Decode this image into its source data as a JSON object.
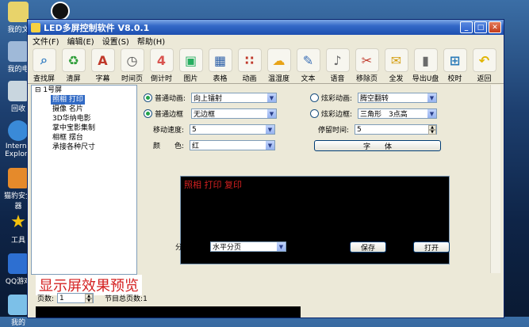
{
  "desktop": {
    "icons": [
      "我的文",
      "我的电",
      "回收",
      "Interne Explore",
      "猫豹安全 器",
      "工具",
      "QQ游戏",
      "我的"
    ]
  },
  "window": {
    "title": "LED多屏控制软件 V8.0.1",
    "menu": [
      "文件(F)",
      "编辑(E)",
      "设置(S)",
      "帮助(H)"
    ]
  },
  "toolbar": {
    "items": [
      {
        "label": "查找屏",
        "icon": "search-icon",
        "color": "#3b82c4"
      },
      {
        "label": "清屏",
        "icon": "recycle-icon",
        "color": "#2f9e3a"
      },
      {
        "label": "字幕",
        "icon": "text-a-icon",
        "color": "#c0392b"
      },
      {
        "label": "时间页",
        "icon": "clock-icon",
        "color": "#555555"
      },
      {
        "label": "倒计时",
        "icon": "calendar-icon",
        "color": "#d9534f"
      },
      {
        "label": "图片",
        "icon": "picture-icon",
        "color": "#27ae60"
      },
      {
        "label": "表格",
        "icon": "table-icon",
        "color": "#2c5fa8"
      },
      {
        "label": "动画",
        "icon": "animation-icon",
        "color": "#c0392b"
      },
      {
        "label": "温湿度",
        "icon": "weather-icon",
        "color": "#e8a317"
      },
      {
        "label": "文本",
        "icon": "document-icon",
        "color": "#3b6fb6"
      },
      {
        "label": "语音",
        "icon": "speaker-icon",
        "color": "#6b6b6b"
      },
      {
        "label": "移除页",
        "icon": "scissors-icon",
        "color": "#c0392b"
      },
      {
        "label": "全发",
        "icon": "send-mail-icon",
        "color": "#d4a017"
      },
      {
        "label": "导出U盘",
        "icon": "usb-icon",
        "color": "#6b6b6b"
      },
      {
        "label": "校时",
        "icon": "windows-icon",
        "color": "#2a7ab8"
      },
      {
        "label": "返回",
        "icon": "back-arrow-icon",
        "color": "#e0b400"
      }
    ]
  },
  "tree": {
    "root": "1号屏",
    "items": [
      "照相 打印",
      "摄像 名片",
      "3D华纳电影",
      "掌中宝影集制",
      "相框 摆台",
      "承接各种尺寸"
    ]
  },
  "settings": {
    "normal_anim_label": "普通动画:",
    "normal_anim_value": "向上镭射",
    "normal_border_label": "普通边框",
    "normal_border_value": "无边框",
    "speed_label": "移动速度:",
    "speed_value": "5",
    "color_label": "颜　　色:",
    "color_value": "红",
    "fancy_anim_label": "炫彩动画:",
    "fancy_anim_value": "腾空翻转",
    "fancy_border_label": "炫彩边框:",
    "fancy_border_value": "三角形　3点高",
    "stay_label": "停留时间:",
    "stay_value": "5",
    "font_button": "字　　体",
    "screen_text": "照相 打印 复印",
    "paging_label": "分页方式:",
    "paging_value": "水平分页",
    "save_button": "保存",
    "open_button": "打开"
  },
  "preview": {
    "title": "显示屏效果预览",
    "page_label": "页数:",
    "page_value": "1",
    "total_label": "节目总页数:1"
  }
}
